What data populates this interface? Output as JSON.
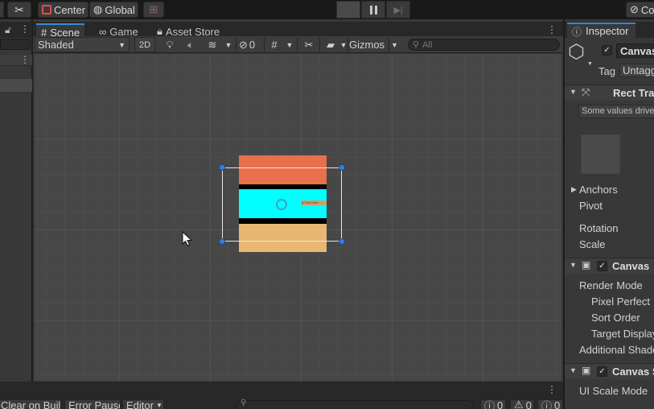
{
  "toolbar": {
    "pivot_label": "Center",
    "space_label": "Global",
    "account_label": "Co"
  },
  "scene": {
    "tabs": [
      {
        "label": "Scene",
        "icon": "grid-icon"
      },
      {
        "label": "Game",
        "icon": "gamepad-icon"
      },
      {
        "label": "Asset Store",
        "icon": "shopping-bag-icon"
      }
    ],
    "shading_mode": "Shaded",
    "mode_2d": "2D",
    "hidden_count": "0",
    "gizmos_label": "Gizmos",
    "search_placeholder": "All",
    "canvas_sample": {
      "bands": [
        "#e8704a",
        "#000000",
        "#00ffff",
        "#000000",
        "#e8b872"
      ],
      "button_text": "● Text Here"
    }
  },
  "inspector": {
    "tab_label": "Inspector",
    "object_name": "Canvas",
    "tag_label": "Tag",
    "tag_value": "Untagg",
    "rect_transform_title": "Rect Tran",
    "driven_notice": "Some values driven",
    "anchors_label": "Anchors",
    "pivot_label": "Pivot",
    "rotation_label": "Rotation",
    "scale_label": "Scale",
    "canvas_title": "Canvas",
    "render_mode_label": "Render Mode",
    "pixel_perfect_label": "Pixel Perfect",
    "sort_order_label": "Sort Order",
    "target_display_label": "Target Display",
    "additional_shader_label": "Additional Shade",
    "canvas_scaler_title": "Canvas S",
    "ui_scale_mode_label": "UI Scale Mode"
  },
  "console": {
    "clear_on_build": "Clear on Build",
    "error_pause": "Error Pause",
    "editor_label": "Editor",
    "info_count": "0",
    "warning_count": "0",
    "error_count": "0"
  },
  "colors": {
    "accent": "#3b86d6",
    "handle": "#3a7ddc",
    "panel": "#383838"
  }
}
